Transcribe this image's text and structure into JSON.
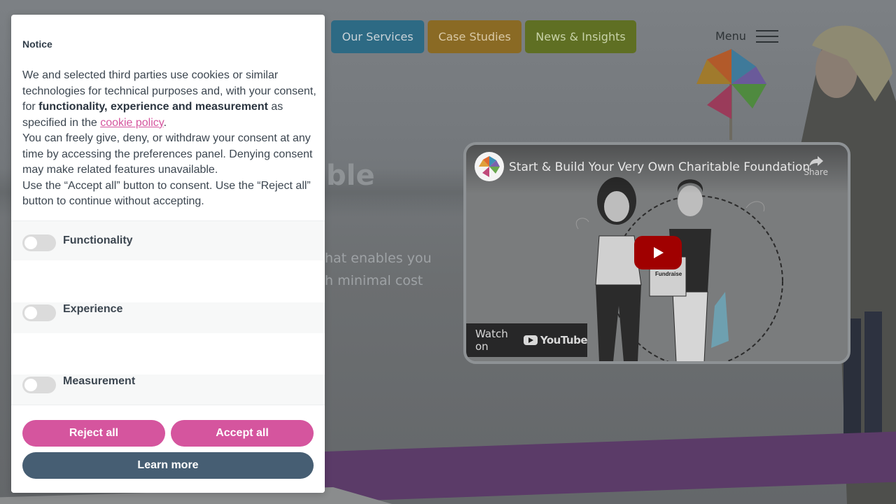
{
  "site": {
    "nav": {
      "services": "Our Services",
      "cases": "Case Studies",
      "news": "News & Insights",
      "menu": "Menu"
    },
    "hero": {
      "title_fragment": "ble",
      "line1": "hat enables you",
      "line2": "h minimal cost"
    },
    "video": {
      "title": "Start & Build Your Very Own Charitable Foundation",
      "share": "Share",
      "watch_on": "Watch on",
      "youtube": "YouTube",
      "sign_text": "Fundraise"
    }
  },
  "cookie_dialog": {
    "title": "Notice",
    "body_part1": "We and selected third parties use cookies or similar technologies for technical purposes and, with your consent, for ",
    "body_bold": "functionality, experience and measurement",
    "body_part2": " as specified in the ",
    "policy_link": "cookie policy",
    "body_part3": ".",
    "body_para2": "You can freely give, deny, or withdraw your consent at any time by accessing the preferences panel. Denying consent may make related features unavailable.",
    "body_para3": "Use the “Accept all” button to consent. Use the “Reject all” button to continue without accepting.",
    "preferences": {
      "functionality": "Functionality",
      "experience": "Experience",
      "measurement": "Measurement"
    },
    "buttons": {
      "reject": "Reject all",
      "accept": "Accept all",
      "learn": "Learn more"
    }
  },
  "colors": {
    "accent_pink": "#d5559e",
    "learn_more_blue": "#465e73"
  }
}
